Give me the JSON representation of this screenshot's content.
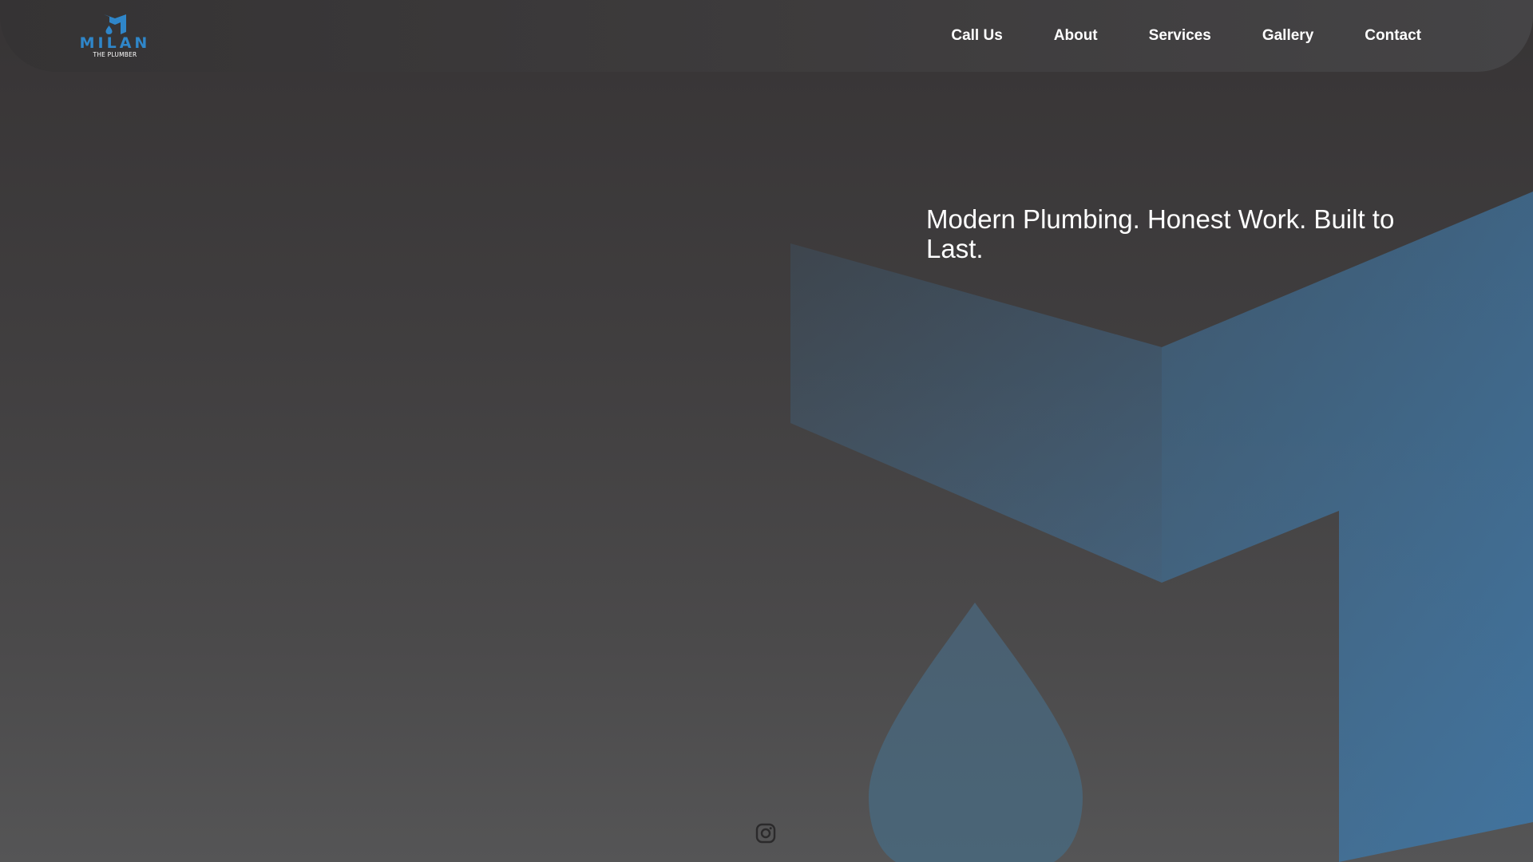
{
  "brand": {
    "name": "MILAN",
    "tagline": "THE PLUMBER",
    "color": "#2f86c9"
  },
  "nav": {
    "items": [
      {
        "label": "Call Us"
      },
      {
        "label": "About"
      },
      {
        "label": "Services"
      },
      {
        "label": "Gallery"
      },
      {
        "label": "Contact"
      }
    ]
  },
  "hero": {
    "title": "Modern Plumbing. Honest Work. Built to Last."
  },
  "social": {
    "icon": "instagram-icon"
  },
  "colors": {
    "background_top": "#373435",
    "background_bottom": "#555556",
    "mark_blue": "#3f6f96",
    "text": "#ffffff"
  }
}
